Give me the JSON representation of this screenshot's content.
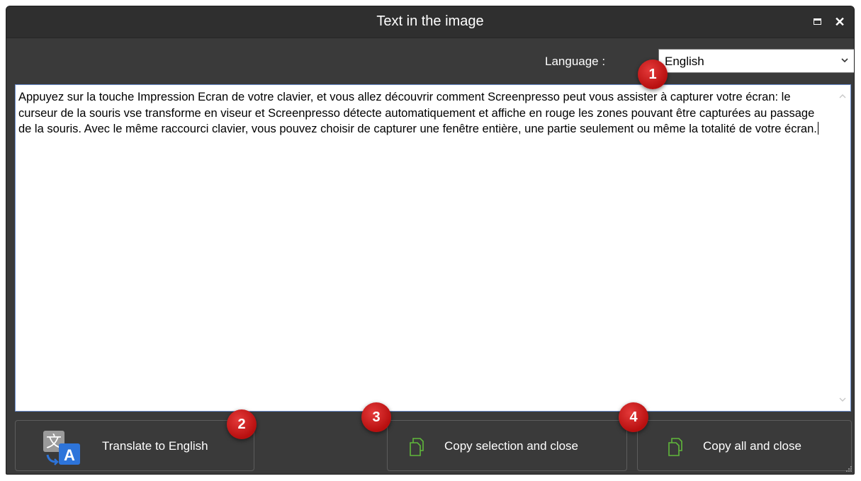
{
  "window": {
    "title": "Text in the image"
  },
  "language": {
    "label": "Language :",
    "value": "English"
  },
  "text": {
    "content": "Appuyez sur la touche Impression Ecran de votre clavier, et vous allez découvrir comment Screenpresso peut vous assister à capturer votre écran: le curseur de la souris vse transforme en viseur et Screenpresso détecte automatiquement et affiche en rouge les zones pouvant être capturées au passage de la souris. Avec le même raccourci clavier, vous pouvez choisir de capturer une fenêtre entière, une partie seulement ou même la totalité de votre écran."
  },
  "buttons": {
    "translate": "Translate to English",
    "copy_selection": "Copy selection and close",
    "copy_all": "Copy all and close"
  },
  "badges": [
    "1",
    "2",
    "3",
    "4"
  ],
  "icons": {
    "translate": "translate-icon",
    "copy": "copy-icon",
    "maximize": "maximize-icon",
    "close": "close-icon",
    "dropdown": "chevron-down-icon"
  },
  "colors": {
    "badge": "#c91818",
    "copy_icon": "#5fb83a",
    "translate_a": "#2d74da",
    "window_bg": "#3a3a3a"
  }
}
